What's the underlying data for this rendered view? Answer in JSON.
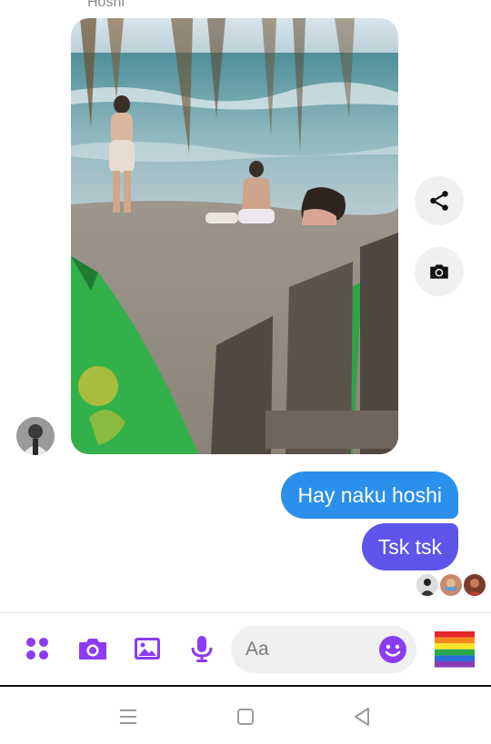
{
  "thread": {
    "sender_name": "Hoshi"
  },
  "messages": [
    {
      "text": "Hay naku hoshi"
    },
    {
      "text": "Tsk tsk"
    }
  ],
  "composer": {
    "placeholder": "Aa"
  },
  "colors": {
    "accent": "#8b3cf0",
    "bubble_blue": "#2a90ec",
    "bubble_purple": "#5d55ea"
  },
  "icons": {
    "share": "share-icon",
    "camera_side": "camera-icon",
    "apps": "apps-icon",
    "camera": "camera-icon",
    "gallery": "image-icon",
    "mic": "microphone-icon",
    "emoji": "smiley-icon",
    "quick_reaction": "rainbow-flag-icon",
    "nav_menu": "menu-icon",
    "nav_home": "home-icon",
    "nav_back": "back-icon"
  }
}
